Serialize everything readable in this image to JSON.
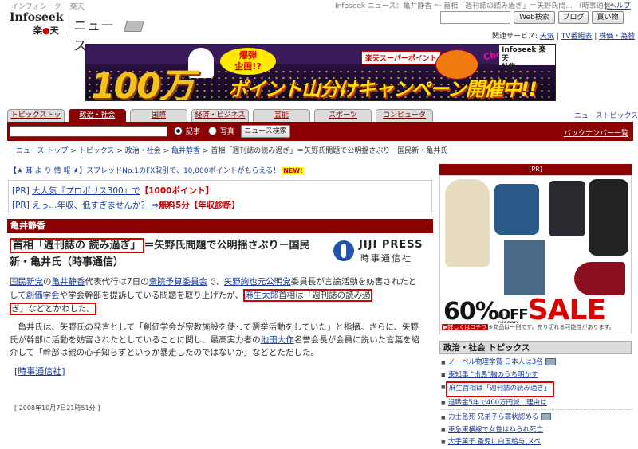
{
  "top": {
    "links": [
      "インフォシーク",
      "楽天"
    ],
    "title": "Infoseek ニュース：亀井静香 ～ 首相「週刊誌の読み過ぎ」＝矢野氏問... （時事通信）",
    "help": "| ヘルプ"
  },
  "logo": {
    "brand": "Infoseek",
    "sub_pre": "楽",
    "sub_mid": "天",
    "section": "ニュース"
  },
  "header": {
    "buttons": [
      "Web検索",
      "ブログ",
      "買い物"
    ],
    "related_label": "関連サービス:",
    "related_links": [
      "天気",
      "TV番組表",
      "株価・為替"
    ]
  },
  "banner": {
    "big": "100万",
    "burst_line1": "爆弾",
    "burst_line2": "企画!?",
    "super_point": "楽天スーパーポイント",
    "choco": "Choco",
    "campaign": "ポイント山分けキャンペーン開催中!!",
    "toku_brand": "Infoseek 楽天",
    "toku": "特集"
  },
  "tabs": [
    "トピックストップ",
    "政治・社会",
    "国際",
    "経済・ビジネス",
    "芸能",
    "スポーツ",
    "コンピュータ"
  ],
  "newstop": {
    "pre": "ニュース",
    "link": "トピックス"
  },
  "search": {
    "radio1": "記事",
    "radio2": "写真",
    "button": "ニュース検索",
    "backnumber": "バックナンバー一覧"
  },
  "breadcrumb": {
    "items": [
      "ニュース トップ",
      "トピックス",
      "政治・社会",
      "亀井静香"
    ],
    "current": "首相「週刊誌の読み過ぎ」＝矢野氏問題で公明揺さぶり－国民新・亀井氏"
  },
  "ticker": {
    "text": "【★ 耳 よ り 情 報 ★】スプレッドNo.1のFX取引で、10,000ポイントがもらえる！",
    "new": "NEW!"
  },
  "pr": [
    {
      "tag": "[PR]",
      "text": "大人気『プロポリス300』で",
      "red": "【1000ポイント】"
    },
    {
      "tag": "[PR]",
      "text": "えっ…年収、低すぎませんか？ ⇒",
      "red": "無料5分【年収診断】"
    }
  ],
  "section_title": "亀井静香",
  "headline": {
    "boxed": "首相「週刊誌の 読み過ぎ」",
    "rest": "＝矢野氏問題で公明揺さぶり－国民新・亀井氏（時事通信）"
  },
  "jiji": {
    "en": "JIJI PRESS",
    "ja": "時事通信社"
  },
  "body": {
    "p1_a": "国民新党",
    "p1_b": "の",
    "p1_c": "亀井静香",
    "p1_d": "代表代行は7日の",
    "p1_e": "衆院予算委員会",
    "p1_f": "で、",
    "p1_g": "矢野絢也元公明党",
    "p1_h": "委員長が言論活動を妨害されたとして",
    "p1_i": "創価学会",
    "p1_j": "や学会幹部を提訴している問題を取り上げたが、",
    "p1_k": "麻生太郎",
    "p1_l": "首相は「週刊誌の読み過",
    "p1_m": "ぎ」などとかわした。",
    "p2": "亀井氏は、矢野氏の発言として「創価学会が宗教施設を使って選挙活動をしていた」と指摘。さらに、矢野氏が幹部に活動を妨害されたとしていることに関し、最高実力者の",
    "p2_link": "池田大作",
    "p2_end": "名誉会長が会員に説いた言葉を紹介して「幹部は親の心子知らずというか暴走したのではないか」などとただした。",
    "source_bracket_l": "[",
    "source": "時事通信社",
    "source_bracket_r": "]",
    "timestamp": "[ 2008年10月7日21時51分 ]"
  },
  "ad": {
    "pr": "[PR]",
    "sale_pct": "60%",
    "off": "OFF",
    "sale": "SALE",
    "max": "最大",
    "brand": "nissen",
    "detail_btn": "▶詳しくはコチラ",
    "note": "※商品は一例です。売り切れる可能性があります。"
  },
  "topics": {
    "title": "政治・社会 トピックス",
    "items": [
      "ノーベル物理学賞 日本人は3名",
      "東知事 \"出馬\"胸のうち明かす",
      "麻生首相は「週刊誌の読み過ぎ」",
      "退職金5年で400万円減…理由は",
      "力士急死 兄弟子ら罪状認める",
      "東急東横線で女性はねられ死亡",
      "大手菓子 蚤児に白玉給与(スペ"
    ]
  }
}
